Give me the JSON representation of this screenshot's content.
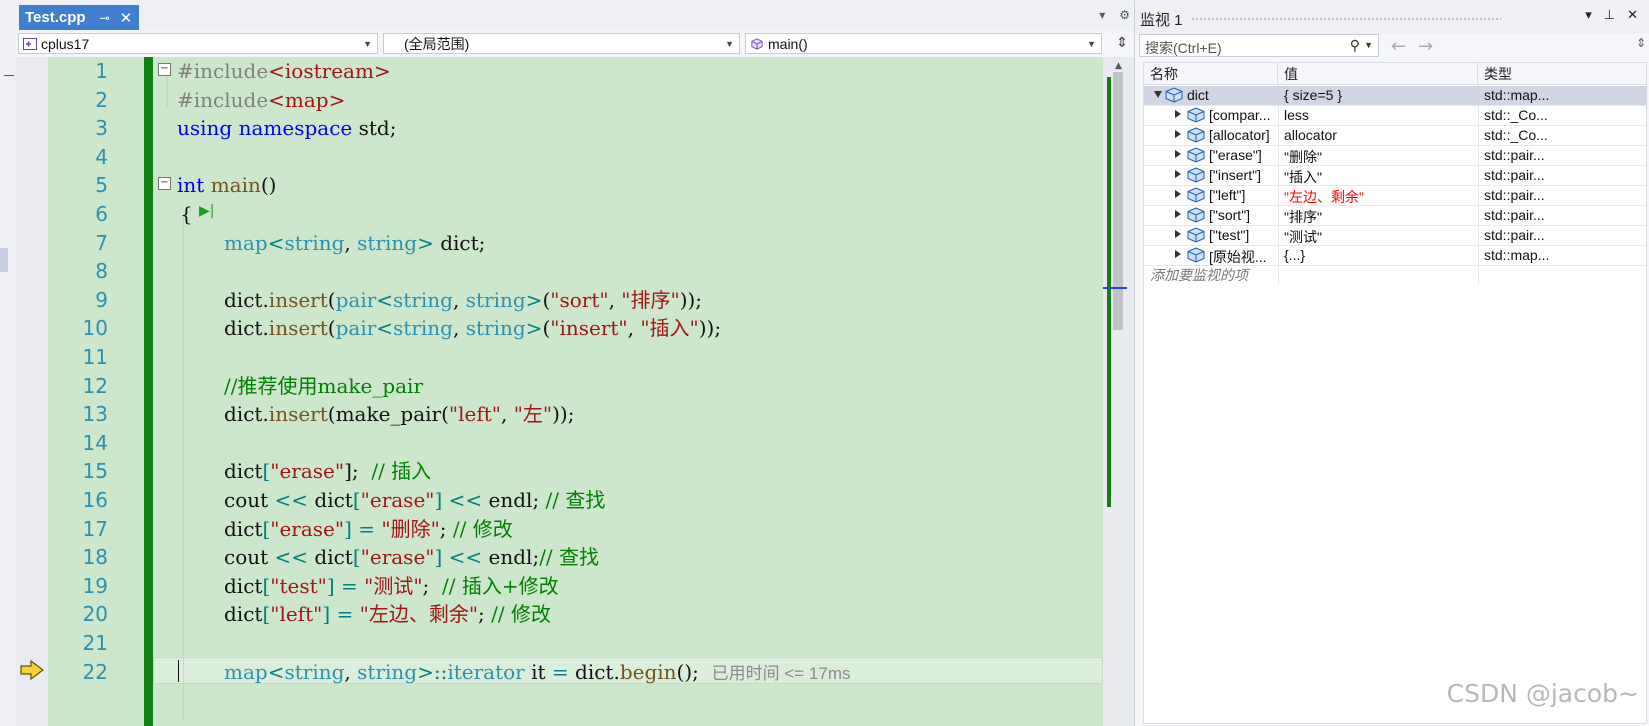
{
  "document_tab": {
    "label": "Test.cpp",
    "pin": "⊸",
    "close": "✕"
  },
  "navigation_bar": {
    "project": "cplus17",
    "scope": "(全局范围)",
    "member": "main()"
  },
  "code_lines": [
    {
      "n": "1"
    },
    {
      "n": "2"
    },
    {
      "n": "3"
    },
    {
      "n": "4"
    },
    {
      "n": "5"
    },
    {
      "n": "6"
    },
    {
      "n": "7"
    },
    {
      "n": "8"
    },
    {
      "n": "9"
    },
    {
      "n": "10"
    },
    {
      "n": "11"
    },
    {
      "n": "12"
    },
    {
      "n": "13"
    },
    {
      "n": "14"
    },
    {
      "n": "15"
    },
    {
      "n": "16"
    },
    {
      "n": "17"
    },
    {
      "n": "18"
    },
    {
      "n": "19"
    },
    {
      "n": "20"
    },
    {
      "n": "21"
    },
    {
      "n": "22"
    }
  ],
  "code_tokens": {
    "l1": [
      "#include",
      "<iostream>"
    ],
    "l2": [
      "#include",
      "<map>"
    ],
    "l3": [
      "using",
      "namespace",
      "std;"
    ],
    "l5": [
      "int",
      "main",
      "()"
    ],
    "l6": [
      "{"
    ],
    "l7": [
      "map",
      "<",
      "string",
      ", ",
      "string",
      ">",
      " dict;"
    ],
    "l9": [
      "dict.",
      "insert",
      "(",
      "pair",
      "<",
      "string",
      ", ",
      "string",
      ">",
      "(",
      "\"sort\"",
      ", ",
      "\"排序\"",
      "));"
    ],
    "l10": [
      "dict.",
      "insert",
      "(",
      "pair",
      "<",
      "string",
      ", ",
      "string",
      ">",
      "(",
      "\"insert\"",
      ", ",
      "\"插入\"",
      "));"
    ],
    "l12": [
      "//推荐使用make_pair"
    ],
    "l13": [
      "dict.",
      "insert",
      "(make_pair(",
      "\"left\"",
      ", ",
      "\"左\"",
      "));"
    ],
    "l15": [
      "dict",
      "[",
      "\"erase\"",
      "];",
      "  // 插入"
    ],
    "l16": [
      "cout ",
      "<<",
      " dict",
      "[",
      "\"erase\"",
      "] ",
      "<<",
      " endl;",
      " // 查找"
    ],
    "l17": [
      "dict",
      "[",
      "\"erase\"",
      "] ",
      "=",
      " ",
      "\"删除\"",
      ";",
      " // 修改"
    ],
    "l18": [
      "cout ",
      "<<",
      " dict",
      "[",
      "\"erase\"",
      "] ",
      "<<",
      " endl;",
      "// 查找"
    ],
    "l19": [
      "dict",
      "[",
      "\"test\"",
      "] ",
      "=",
      " ",
      "\"测试\"",
      ";",
      "  // 插入+修改"
    ],
    "l20": [
      "dict",
      "[",
      "\"left\"",
      "] ",
      "=",
      " ",
      "\"左边、剩余\"",
      ";",
      " // 修改"
    ],
    "l22": [
      "map",
      "<",
      "string",
      ", ",
      "string",
      ">",
      "::",
      "iterator",
      " it ",
      "=",
      " dict.",
      "begin",
      "();"
    ],
    "elapsed": "已用时间 <= 17ms"
  },
  "watch": {
    "title": "监视 1",
    "search_placeholder": "搜索(Ctrl+E)",
    "columns": {
      "name": "名称",
      "value": "值",
      "type": "类型"
    },
    "rows": [
      {
        "name": "dict",
        "value": "{ size=5 }",
        "type": "std::map...",
        "state": "expanded",
        "selected": true
      },
      {
        "name": "[compar...",
        "value": "less",
        "type": "std::_Co..."
      },
      {
        "name": "[allocator]",
        "value": "allocator",
        "type": "std::_Co..."
      },
      {
        "name": "[\"erase\"]",
        "value": "\"删除\"",
        "type": "std::pair..."
      },
      {
        "name": "[\"insert\"]",
        "value": "\"插入\"",
        "type": "std::pair..."
      },
      {
        "name": "[\"left\"]",
        "value": "\"左边、剩余\"",
        "type": "std::pair...",
        "changed": true
      },
      {
        "name": "[\"sort\"]",
        "value": "\"排序\"",
        "type": "std::pair..."
      },
      {
        "name": "[\"test\"]",
        "value": "\"测试\"",
        "type": "std::pair..."
      },
      {
        "name": "[原始视...",
        "value": "{...}",
        "type": "std::map..."
      }
    ],
    "add_item": "添加要监视的项"
  },
  "colors": {
    "keyword": "#0000ff",
    "type": "#2b91af",
    "string": "#a31515",
    "comment": "#008000",
    "changed_value": "#ff0000",
    "tab_active": "#3f7fd0"
  },
  "watermark": "CSDN @jacob~"
}
